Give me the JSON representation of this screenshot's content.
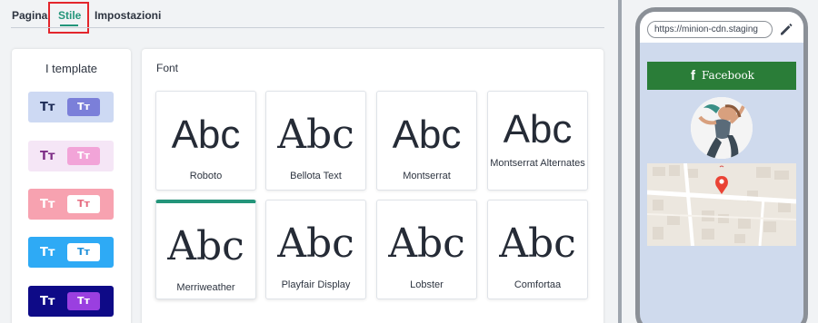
{
  "tabs": [
    {
      "label": "Pagina",
      "active": false
    },
    {
      "label": "Stile",
      "active": true
    },
    {
      "label": "Impostazioni",
      "active": false
    }
  ],
  "templates": {
    "title": "I template",
    "items": [
      {
        "glyph": "Tт",
        "button_glyph": "Tт",
        "bg": "#cdd9f3",
        "tt_color": "#1d2b56",
        "btn_bg": "#7b7fd9",
        "btn_color": "#ffffff"
      },
      {
        "glyph": "Tт",
        "button_glyph": "Tт",
        "bg": "#f5e6f6",
        "tt_color": "#7d2d86",
        "btn_bg": "#f2a4d8",
        "btn_color": "#ffffff"
      },
      {
        "glyph": "Tт",
        "button_glyph": "Tт",
        "bg": "#f7a2b0",
        "tt_color": "#ffffff",
        "btn_bg": "#ffffff",
        "btn_color": "#e66b80"
      },
      {
        "glyph": "Tт",
        "button_glyph": "Tт",
        "bg": "#2eaaf5",
        "tt_color": "#ffffff",
        "btn_bg": "#ffffff",
        "btn_color": "#1e8fd9"
      },
      {
        "glyph": "Tт",
        "button_glyph": "Tт",
        "bg": "#0e0a87",
        "tt_color": "#ffffff",
        "btn_bg": "#9a3fe0",
        "btn_color": "#ffffff"
      }
    ]
  },
  "font_panel": {
    "title": "Font",
    "sample": "Abc",
    "fonts": [
      {
        "name": "Roboto",
        "selected": false
      },
      {
        "name": "Bellota Text",
        "selected": false
      },
      {
        "name": "Montserrat",
        "selected": false
      },
      {
        "name": "Montserrat Alternates",
        "selected": false
      },
      {
        "name": "Merriweather",
        "selected": true
      },
      {
        "name": "Playfair Display",
        "selected": false
      },
      {
        "name": "Lobster",
        "selected": false
      },
      {
        "name": "Comfortaa",
        "selected": false
      }
    ]
  },
  "preview": {
    "url": "https://minion-cdn.staging",
    "facebook_label": "Facebook",
    "facebook_icon": "facebook-f-icon",
    "edit_icon": "pencil-icon"
  },
  "colors": {
    "accent": "#23957a",
    "highlight": "#e3262c",
    "facebook_green": "#2a7d38",
    "phone_bg": "#cfdaed"
  }
}
